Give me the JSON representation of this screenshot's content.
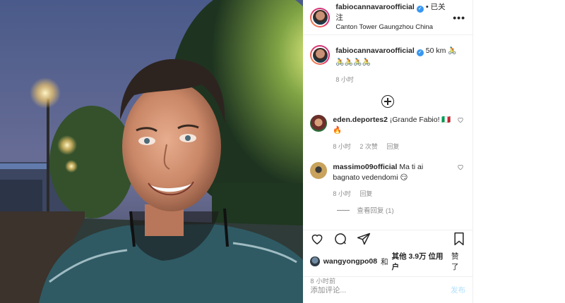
{
  "header": {
    "username": "fabiocannavaroofficial",
    "verified_mark": "✓",
    "dot": "•",
    "follow_state": "已关注",
    "location": "Canton Tower Gaungzhou China",
    "more": "•••"
  },
  "caption": {
    "username": "fabiocannavaroofficial",
    "text": "50 km",
    "bikes_line1": "🚴",
    "bikes_line2": "🚴🚴🚴🚴",
    "time": "8 小时"
  },
  "comments": [
    {
      "username": "eden.deportes2",
      "text": "¡Grande Fabio! 🇮🇹",
      "text2": "🔥",
      "time": "8 小时",
      "likes": "2 次赞",
      "reply": "回复",
      "avatar_color": "#6b2f2a"
    },
    {
      "username": "massimo09official",
      "text": "Ma ti ai bagnato vedendomi 😏",
      "time": "8 小时",
      "reply": "回复",
      "avatar_color": "#c9a25c"
    }
  ],
  "view_replies": "查看回复 (1)",
  "likes": {
    "liker": "wangyongpo08",
    "and": "和",
    "others": "其他 3.9万 位用户",
    "liked": "赞了"
  },
  "post_time": "8 小时前",
  "add_comment": {
    "placeholder": "添加评论...",
    "post_label": "发布"
  },
  "icons": [
    "heart-icon",
    "comment-icon",
    "share-icon",
    "bookmark-icon",
    "add-circle-icon",
    "more-icon",
    "verified-icon"
  ]
}
